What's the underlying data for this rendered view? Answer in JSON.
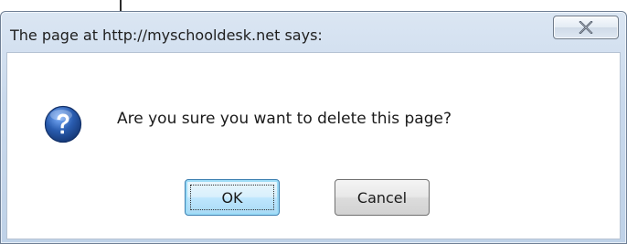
{
  "dialog": {
    "title": "The page at http://myschooldesk.net says:",
    "close_icon": "close-icon",
    "icon": "question-icon",
    "message": "Are you sure you want to delete this page?",
    "buttons": {
      "ok_label": "OK",
      "cancel_label": "Cancel"
    }
  },
  "colors": {
    "frame": "#c9d9ec",
    "ok_accent": "#3c7fb1",
    "icon_blue": "#2a5db0"
  }
}
